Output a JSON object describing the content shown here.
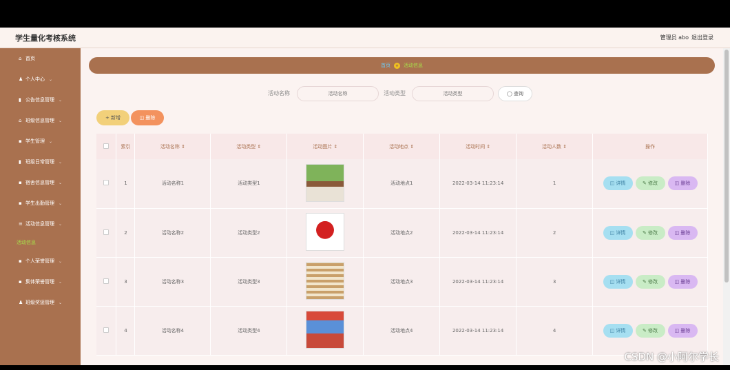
{
  "header": {
    "app_title": "学生量化考核系统",
    "admin": "管理员 abo",
    "logout": "退出登录"
  },
  "sidebar": {
    "items": [
      {
        "icon": "home-icon",
        "glyph": "⌂",
        "label": "首页",
        "chev": ""
      },
      {
        "icon": "user-icon",
        "glyph": "♟",
        "label": "个人中心",
        "chev": "⌄"
      },
      {
        "icon": "chart-icon",
        "glyph": "▮",
        "label": "公告信息管理",
        "chev": "⌄"
      },
      {
        "icon": "bank-icon",
        "glyph": "⌂",
        "label": "班级信息管理",
        "chev": "⌄"
      },
      {
        "icon": "grid-icon",
        "glyph": "▪",
        "label": "学生管理",
        "chev": "⌄"
      },
      {
        "icon": "chart-icon",
        "glyph": "▮",
        "label": "班级日常管理",
        "chev": "⌄"
      },
      {
        "icon": "grid-icon",
        "glyph": "▪",
        "label": "宿舍信息管理",
        "chev": "⌄"
      },
      {
        "icon": "grid-icon",
        "glyph": "▪",
        "label": "学生出勤管理",
        "chev": "⌄"
      },
      {
        "icon": "list-icon",
        "glyph": "≡",
        "label": "活动信息管理",
        "chev": "⌄"
      }
    ],
    "sub_item": "活动信息",
    "items2": [
      {
        "icon": "grid-icon",
        "glyph": "▪",
        "label": "个人荣誉管理",
        "chev": "⌄"
      },
      {
        "icon": "grid-icon",
        "glyph": "▪",
        "label": "集体荣誉管理",
        "chev": "⌄"
      },
      {
        "icon": "user-icon",
        "glyph": "♟",
        "label": "班级奖惩管理",
        "chev": "⌄"
      }
    ]
  },
  "breadcrumb": {
    "home": "首页",
    "current": "活动信息"
  },
  "search": {
    "name_label": "活动名称",
    "name_placeholder": "活动名称",
    "type_label": "活动类型",
    "type_placeholder": "活动类型",
    "button": "◯ 查询"
  },
  "actions": {
    "add": "+ 新增",
    "delete": "◫ 删除"
  },
  "table": {
    "headers": [
      "索引",
      "活动名称 ⇕",
      "活动类型 ⇕",
      "活动图片 ⇕",
      "活动地点 ⇕",
      "活动时间 ⇕",
      "活动人数 ⇕",
      "操作"
    ],
    "rows": [
      {
        "index": "1",
        "name": "活动名称1",
        "type": "活动类型1",
        "place": "活动地点1",
        "time": "2022-03-14 11:23:14",
        "count": "1"
      },
      {
        "index": "2",
        "name": "活动名称2",
        "type": "活动类型2",
        "place": "活动地点2",
        "time": "2022-03-14 11:23:14",
        "count": "2"
      },
      {
        "index": "3",
        "name": "活动名称3",
        "type": "活动类型3",
        "place": "活动地点3",
        "time": "2022-03-14 11:23:14",
        "count": "3"
      },
      {
        "index": "4",
        "name": "活动名称4",
        "type": "活动类型4",
        "place": "活动地点4",
        "time": "2022-03-14 11:23:14",
        "count": "4"
      }
    ],
    "op_detail": "◫ 详情",
    "op_edit": "✎ 修改",
    "op_delete": "◫ 删除"
  },
  "watermark": "CSDN @小阿尔学长"
}
